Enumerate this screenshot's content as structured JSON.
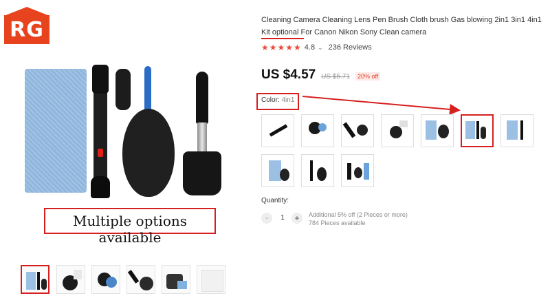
{
  "store": {
    "logo_text": "RG"
  },
  "main_image": {
    "caption": "Multiple options available"
  },
  "thumbnails": [
    "thumb-1",
    "thumb-2",
    "thumb-3",
    "thumb-4",
    "thumb-5",
    "thumb-6"
  ],
  "product": {
    "title": "Cleaning Camera Cleaning Lens Pen Brush Cloth brush Gas blowing 2in1 3in1 4in1 Kit optional For Canon Nikon Sony Clean camera",
    "rating": {
      "stars": "★★★★★",
      "value": "4.8",
      "chevron": "⌄",
      "reviews": "236 Reviews"
    },
    "price": {
      "current": "US $4.57",
      "original": "US $5.71",
      "discount": "20% off"
    }
  },
  "color": {
    "label": "Color:",
    "selected": "4in1"
  },
  "quantity": {
    "label": "Quantity:",
    "minus": "-",
    "value": "1",
    "plus": "+",
    "discount_note": "Additional 5% off (2 Pieces or more)",
    "available": "784 Pieces available"
  },
  "colors": {
    "accent": "#d61f1f",
    "logo": "#e8431f",
    "stars": "#e84b3c"
  }
}
